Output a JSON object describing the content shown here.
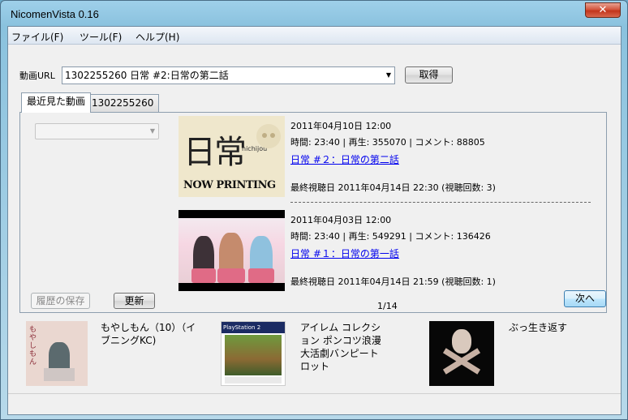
{
  "window": {
    "title": "NicomenVista 0.16",
    "close_label": "✕"
  },
  "menu": {
    "items": [
      "ファイル(F)",
      "ツール(F)",
      "ヘルプ(H)"
    ]
  },
  "url_bar": {
    "label": "動画URL",
    "value": "1302255260 日常 #2:日常の第二話",
    "fetch_label": "取得"
  },
  "tabs": [
    {
      "label": "最近見た動画",
      "active": true
    },
    {
      "label": "1302255260",
      "active": false
    }
  ],
  "history": {
    "thumb1": {
      "logo": "日常",
      "logo_sub": "nichijou",
      "banner": "NOW PRINTING"
    },
    "entries": [
      {
        "date": "2011年04月10日 12:00",
        "stats": "時間: 23:40 | 再生: 355070 | コメント: 88805",
        "title": "日常 #２：日常の第二話",
        "last_viewed": "最終視聴日 2011年04月14日 22:30 (視聴回数: 3)"
      },
      {
        "date": "2011年04月03日 12:00",
        "stats": "時間: 23:40 | 再生: 549291 | コメント: 136426",
        "title": "日常 #１：日常の第一話",
        "last_viewed": "最終視聴日 2011年04月14日 21:59 (視聴回数: 1)"
      }
    ],
    "save_label": "履歴の保存",
    "refresh_label": "更新",
    "page_counter": "1/14",
    "next_label": "次へ"
  },
  "products": [
    {
      "title": "もやしもん（10）（イブニングKC)",
      "cover_text": "もやしもん"
    },
    {
      "title": "アイレム コレクション ポンコツ浪漫大活劇バンピートロット",
      "cover_text": "PlayStation 2"
    },
    {
      "title": "ぶっ生き返す"
    }
  ]
}
